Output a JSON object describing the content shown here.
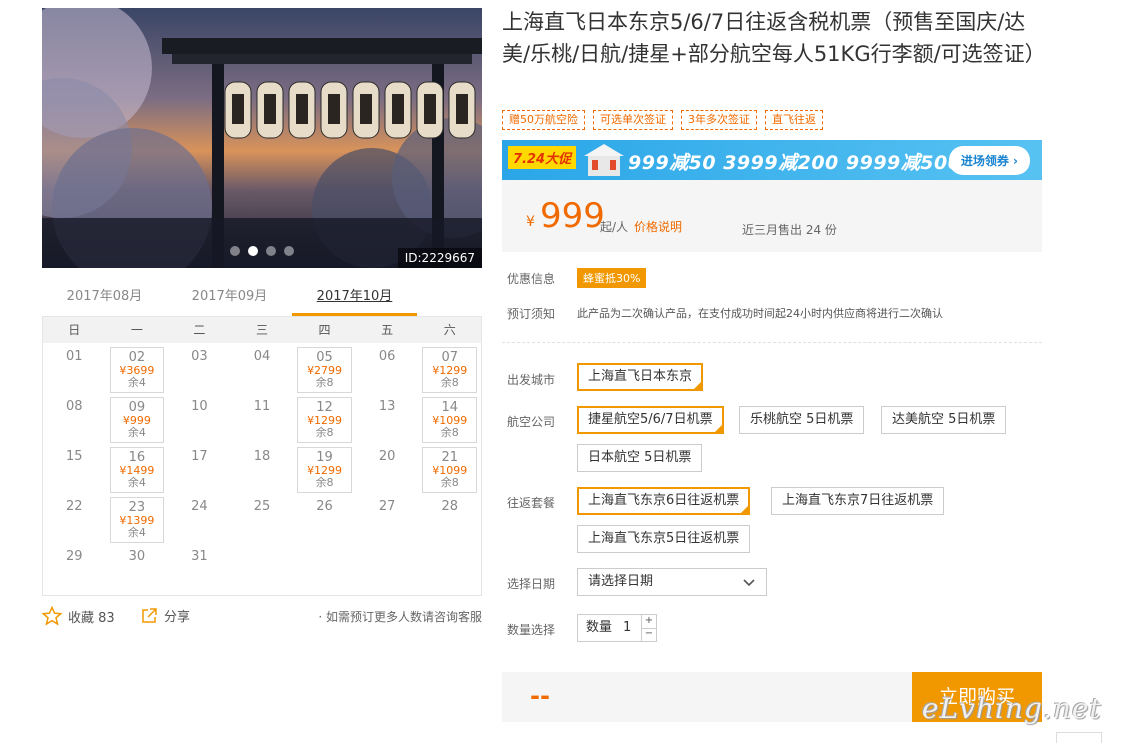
{
  "product": {
    "image_id": "ID:2229667",
    "title": "上海直飞日本东京5/6/7日往返含税机票（预售至国庆/达美/乐桃/日航/捷星+部分航空每人51KG行李额/可选签证）",
    "tags": [
      "赠50万航空险",
      "可选单次签证",
      "3年多次签证",
      "直飞往返"
    ]
  },
  "promo": {
    "badge": "7.24大促",
    "text": "999减50  3999减200  9999减500",
    "button": "进场领券 ›"
  },
  "price": {
    "currency": "¥",
    "amount": "999",
    "unit": "起/人",
    "explain": "价格说明",
    "sold": "近三月售出 24 份"
  },
  "calendar": {
    "months": [
      "2017年08月",
      "2017年09月",
      "2017年10月"
    ],
    "active_month": 2,
    "weekdays": [
      "日",
      "一",
      "二",
      "三",
      "四",
      "五",
      "六"
    ],
    "days": [
      {
        "d": "01"
      },
      {
        "d": "02",
        "p": "¥3699",
        "r": "余4"
      },
      {
        "d": "03"
      },
      {
        "d": "04"
      },
      {
        "d": "05",
        "p": "¥2799",
        "r": "余8"
      },
      {
        "d": "06"
      },
      {
        "d": "07",
        "p": "¥1299",
        "r": "余8"
      },
      {
        "d": "08"
      },
      {
        "d": "09",
        "p": "¥999",
        "r": "余4"
      },
      {
        "d": "10"
      },
      {
        "d": "11"
      },
      {
        "d": "12",
        "p": "¥1299",
        "r": "余8"
      },
      {
        "d": "13"
      },
      {
        "d": "14",
        "p": "¥1099",
        "r": "余8"
      },
      {
        "d": "15"
      },
      {
        "d": "16",
        "p": "¥1499",
        "r": "余4"
      },
      {
        "d": "17"
      },
      {
        "d": "18"
      },
      {
        "d": "19",
        "p": "¥1299",
        "r": "余8"
      },
      {
        "d": "20"
      },
      {
        "d": "21",
        "p": "¥1099",
        "r": "余8"
      },
      {
        "d": "22"
      },
      {
        "d": "23",
        "p": "¥1399",
        "r": "余4"
      },
      {
        "d": "24"
      },
      {
        "d": "25"
      },
      {
        "d": "26"
      },
      {
        "d": "27"
      },
      {
        "d": "28"
      },
      {
        "d": "29"
      },
      {
        "d": "30"
      },
      {
        "d": "31"
      }
    ]
  },
  "actions": {
    "favorite": "收藏 83",
    "share": "分享",
    "consult": "· 如需预订更多人数请咨询客服"
  },
  "info": {
    "discount_label": "优惠信息",
    "discount": "蜂蜜抵30%",
    "notice_label": "预订须知",
    "notice": "此产品为二次确认产品，在支付成功时间起24小时内供应商将进行二次确认"
  },
  "options": {
    "city_label": "出发城市",
    "city": "上海直飞日本东京",
    "airline_label": "航空公司",
    "airlines": [
      "捷星航空5/6/7日机票",
      "乐桃航空 5日机票",
      "达美航空 5日机票",
      "日本航空 5日机票"
    ],
    "package_label": "往返套餐",
    "packages": [
      "上海直飞东京6日往返机票",
      "上海直飞东京7日往返机票",
      "上海直飞东京5日往返机票"
    ],
    "date_label": "选择日期",
    "date_placeholder": "请选择日期",
    "qty_label": "数量选择",
    "qty_text": "数量",
    "qty_value": "1"
  },
  "buy": {
    "total": "--",
    "button": "立即购买"
  },
  "watermark": "eLvhing.net",
  "colors": {
    "accent": "#f19800",
    "price": "#f06a00"
  }
}
